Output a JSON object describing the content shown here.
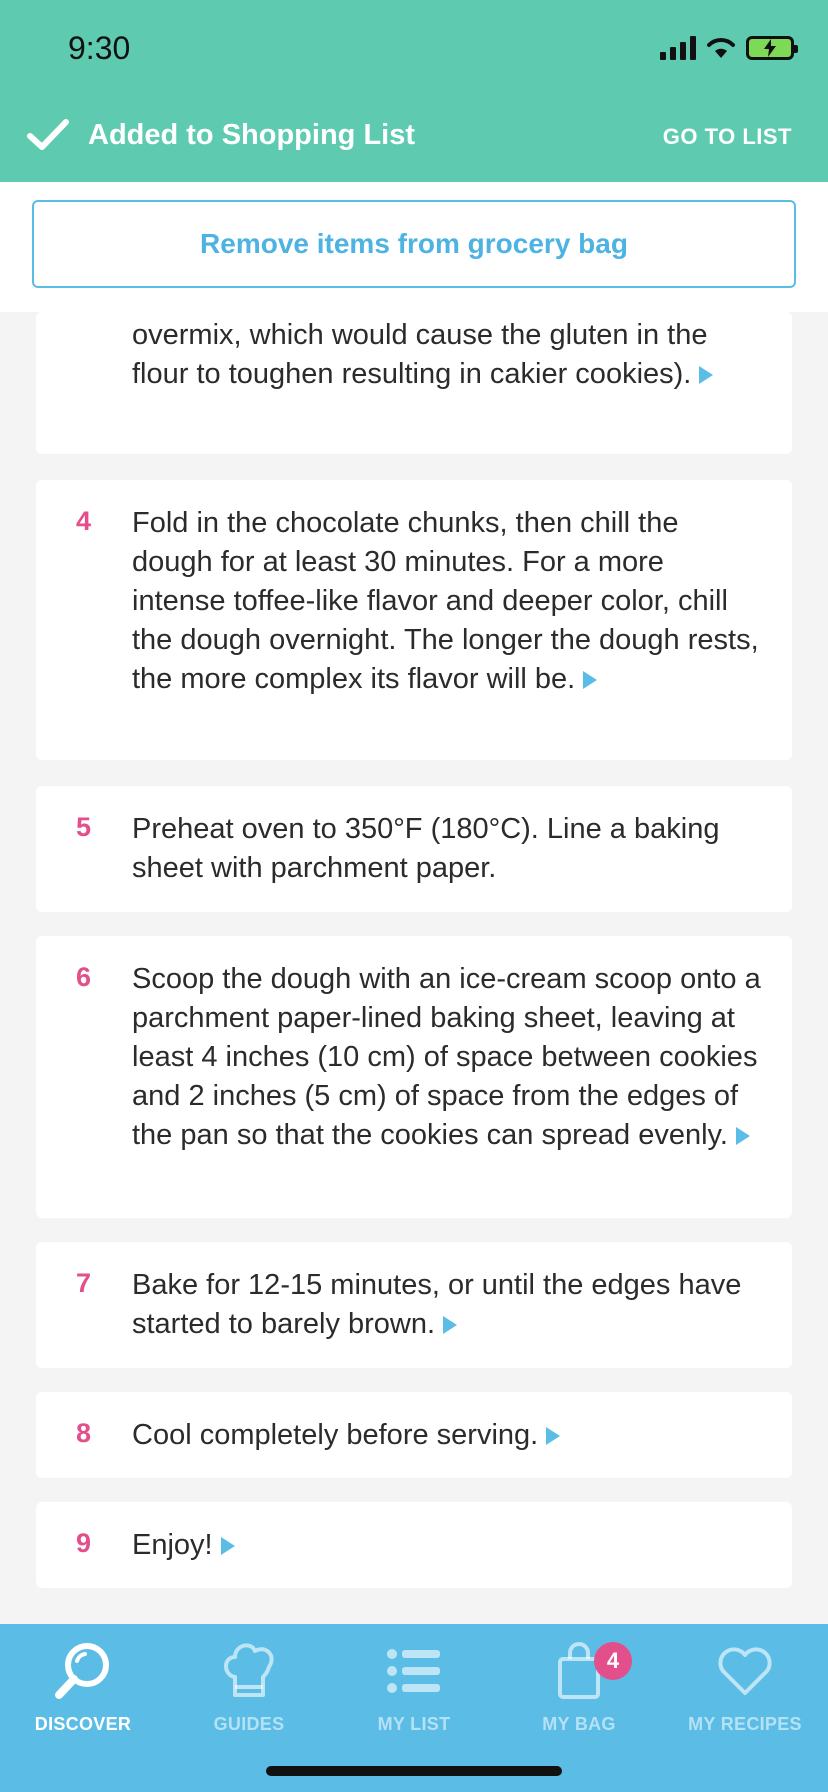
{
  "status_bar": {
    "time": "9:30"
  },
  "banner": {
    "added_label": "Added to Shopping List",
    "go_to_list": "GO TO LIST"
  },
  "remove_button": {
    "label": "Remove items from grocery bag"
  },
  "steps": [
    {
      "number": "",
      "text": "overmix, which would cause the gluten in the flour to toughen resulting in cakier cookies)."
    },
    {
      "number": "4",
      "text": "Fold in the chocolate chunks, then chill the dough for at least 30 minutes. For a more intense toffee-like flavor and deeper color, chill the dough overnight. The longer the dough rests, the more complex its flavor will be."
    },
    {
      "number": "5",
      "text": "Preheat oven to 350°F (180°C). Line a baking sheet with parchment paper."
    },
    {
      "number": "6",
      "text": "Scoop the dough with an ice-cream scoop onto a parchment paper-lined baking sheet, leaving at least 4 inches (10 cm) of space between cookies and 2 inches (5 cm)  of space from the edges of the pan so that the cookies can spread evenly."
    },
    {
      "number": "7",
      "text": "Bake for 12-15 minutes, or until the edges have started to barely brown."
    },
    {
      "number": "8",
      "text": "Cool completely before serving."
    },
    {
      "number": "9",
      "text": "Enjoy!"
    }
  ],
  "nav": {
    "items": [
      {
        "label": "DISCOVER",
        "icon": "search-icon"
      },
      {
        "label": "GUIDES",
        "icon": "chef-hat-icon"
      },
      {
        "label": "MY LIST",
        "icon": "list-icon"
      },
      {
        "label": "MY BAG",
        "icon": "bag-icon"
      },
      {
        "label": "MY RECIPES",
        "icon": "heart-icon"
      }
    ],
    "bag_badge": "4"
  },
  "colors": {
    "banner": "#5ecbb1",
    "accent_blue": "#5bbde6",
    "step_number": "#e24f8b"
  }
}
